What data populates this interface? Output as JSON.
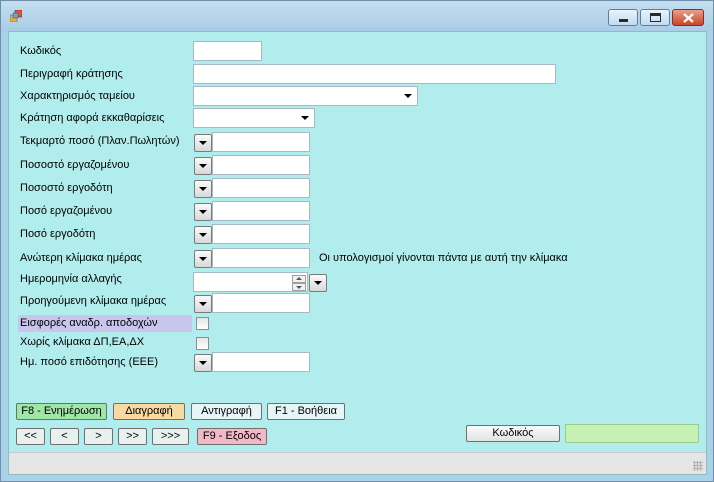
{
  "window": {
    "title": "",
    "icon": "app-icon",
    "controls": [
      "minimize-icon",
      "maximize-icon",
      "close-icon"
    ]
  },
  "form": {
    "fields": {
      "code": {
        "label": "Κωδικός",
        "value": ""
      },
      "description": {
        "label": "Περιγραφή κράτησης",
        "value": ""
      },
      "fund": {
        "label": "Χαρακτηρισμός ταμείου",
        "value": ""
      },
      "clearing": {
        "label": "Κράτηση αφορά εκκαθαρίσεις",
        "value": ""
      },
      "imputed": {
        "label": "Τεκμαρτό ποσό (Πλαν.Πωλητών)",
        "value": ""
      },
      "employee_pct": {
        "label": "Ποσοστό εργαζομένου",
        "value": ""
      },
      "employer_pct": {
        "label": "Ποσοστό εργοδότη",
        "value": ""
      },
      "employee_amt": {
        "label": "Ποσό εργαζομένου",
        "value": ""
      },
      "employer_amt": {
        "label": "Ποσό εργοδότη",
        "value": ""
      },
      "upper_scale": {
        "label": "Ανώτερη κλίμακα ημέρας",
        "value": "",
        "note": "Οι υπολογισμοί γίνονται πάντα με αυτή την κλίμακα"
      },
      "change_date": {
        "label": "Ημερομηνία αλλαγής",
        "value": ""
      },
      "prev_scale": {
        "label": "Προηγούμενη κλίμακα ημέρας",
        "value": ""
      },
      "retro": {
        "label": "Εισφορές αναδρ. αποδοχών",
        "checked": false
      },
      "no_scale": {
        "label": "Χωρίς κλίμακα ΔΠ,ΕΑ,ΔΧ",
        "checked": false
      },
      "subsidy": {
        "label": "Ημ. ποσό επιδότησης (ΕΕΕ)",
        "value": ""
      }
    }
  },
  "actions": {
    "update": "F8 - Ενημέρωση",
    "delete": "Διαγραφή",
    "copy": "Αντιγραφή",
    "help": "F1 - Βοήθεια",
    "exit": "F9 - Εξοδος"
  },
  "nav": {
    "first": "<<",
    "prev": "<",
    "next": ">",
    "next_page": ">>",
    "last": ">>>"
  },
  "search": {
    "button": "Κωδικός",
    "value": ""
  },
  "colors": {
    "client_bg": "#b2eded",
    "highlight_row": "#c9c6ee",
    "update_button": "#9ee7a6",
    "delete_button": "#f7d9a1",
    "exit_button": "#f3b8c6",
    "search_field": "#c6f1b4"
  }
}
